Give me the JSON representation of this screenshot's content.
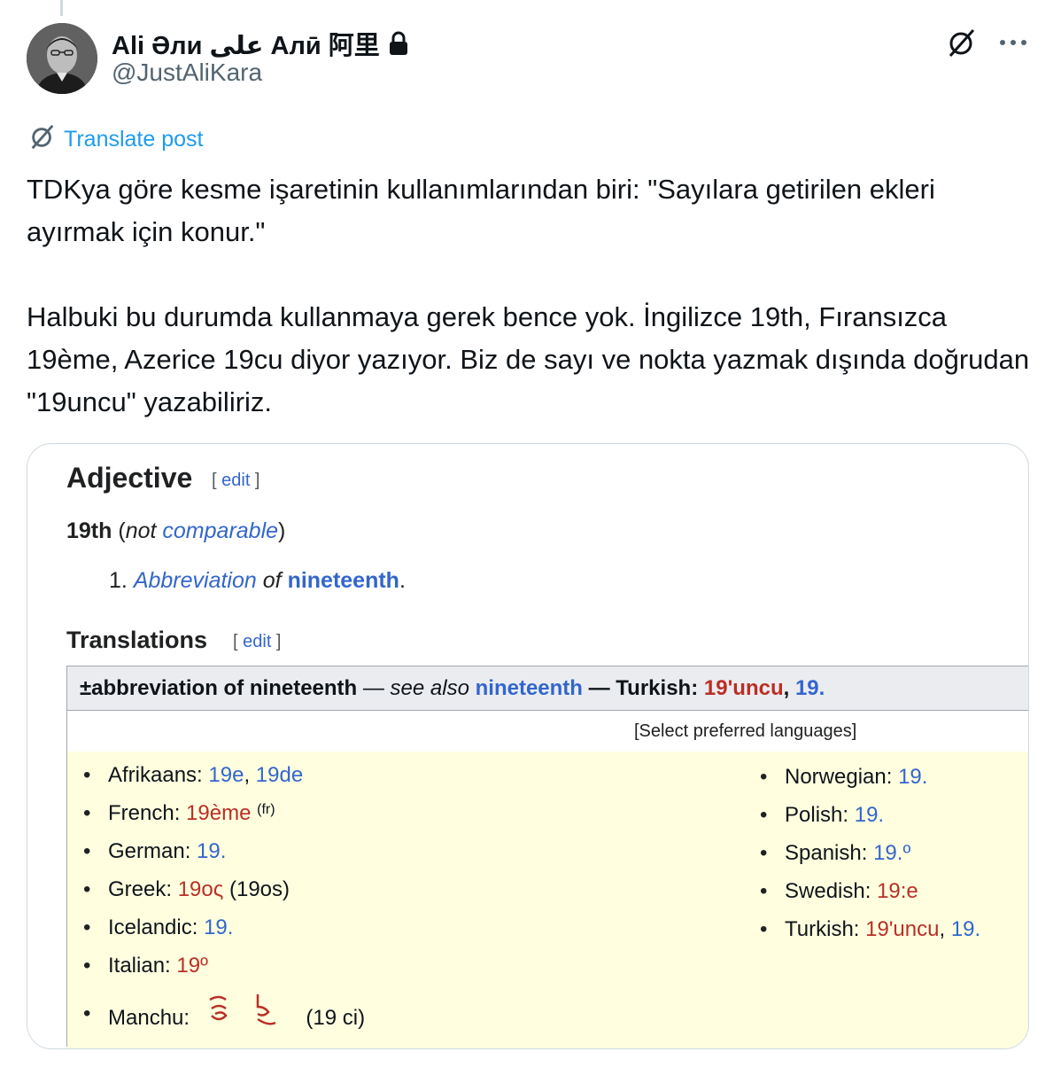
{
  "author": {
    "display_name": "Ali Әли علی Алӣ 阿里",
    "handle": "@JustAliKara"
  },
  "translate_label": "Translate post",
  "post_text": "TDKya göre kesme işaretinin kullanımlarından biri: \"Sayılara getirilen ekleri ayırmak için konur.\"\n\nHalbuki bu durumda kullanmaya gerek bence yok. İngilizce 19th, Fıransızca 19ème, Azerice 19cu diyor yazıyor. Biz de sayı ve nokta yazmak dışında doğrudan \"19uncu\" yazabiliriz.",
  "icons": {
    "grok": "grok-icon",
    "more": "more-icon",
    "translate": "translate-icon",
    "lock": "lock-icon"
  },
  "wiktionary": {
    "adjective_heading": "Adjective",
    "edit_label": "edit",
    "headword": "19th",
    "not_label": "not",
    "comparable_label": "comparable",
    "def_number": "1.",
    "def_abbrev": "Abbreviation",
    "def_of": "of",
    "def_target": "nineteenth",
    "translations_heading": "Translations",
    "table_head": {
      "gloss": "±abbreviation of nineteenth",
      "see_also": "see also",
      "see_target": "nineteenth",
      "turkish_label": "Turkish:",
      "turkish_red": "19'uncu",
      "turkish_blue": "19."
    },
    "select_languages": "[Select preferred languages]",
    "left_column": [
      {
        "lang": "Afrikaans:",
        "a": "19e",
        "b": "19de"
      },
      {
        "lang": "French:",
        "a": "19ème",
        "sup": "(fr)"
      },
      {
        "lang": "German:",
        "a": "19."
      },
      {
        "lang": "Greek:",
        "a": "19ος",
        "note": "(19os)"
      },
      {
        "lang": "Icelandic:",
        "a": "19."
      },
      {
        "lang": "Italian:",
        "a": "19º"
      },
      {
        "lang": "Manchu:",
        "a": "ᡂᡃ",
        "note": "(19 ci)"
      }
    ],
    "right_column": [
      {
        "lang": "Norwegian:",
        "a": "19."
      },
      {
        "lang": "Polish:",
        "a": "19."
      },
      {
        "lang": "Spanish:",
        "a": "19.º"
      },
      {
        "lang": "Swedish:",
        "a": "19:e"
      },
      {
        "lang": "Turkish:",
        "a": "19'uncu",
        "b": "19."
      }
    ],
    "colors": {
      "link_blue": "#3366cc",
      "redlink": "#ba2f25",
      "table_bg": "#ffffe0",
      "head_bg": "#eaecf0"
    }
  }
}
